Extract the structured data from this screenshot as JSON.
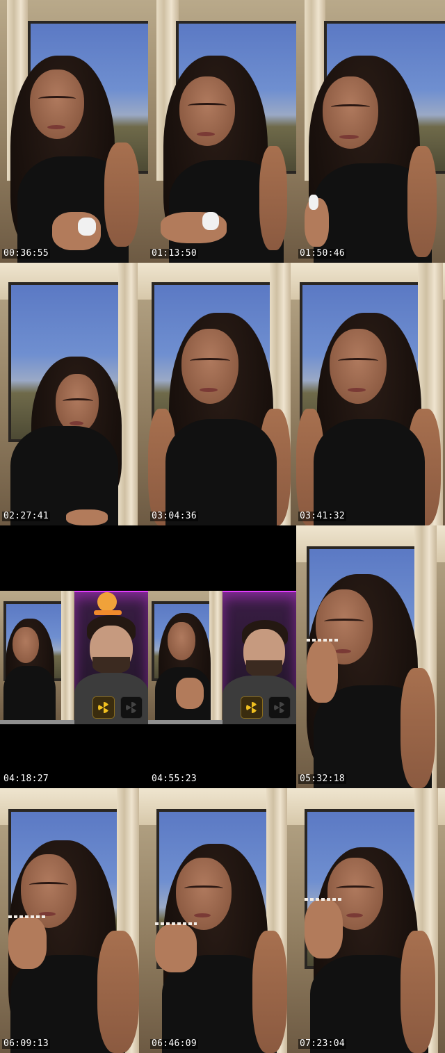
{
  "contact_sheet": {
    "frames": [
      {
        "timestamp": "00:36:55"
      },
      {
        "timestamp": "01:13:50"
      },
      {
        "timestamp": "01:50:46"
      },
      {
        "timestamp": "02:27:41"
      },
      {
        "timestamp": "03:04:36"
      },
      {
        "timestamp": "03:41:32"
      },
      {
        "timestamp": "04:18:27"
      },
      {
        "timestamp": "04:55:23"
      },
      {
        "timestamp": "05:32:18"
      },
      {
        "timestamp": "06:09:13"
      },
      {
        "timestamp": "06:46:09"
      },
      {
        "timestamp": "07:23:04"
      }
    ]
  }
}
